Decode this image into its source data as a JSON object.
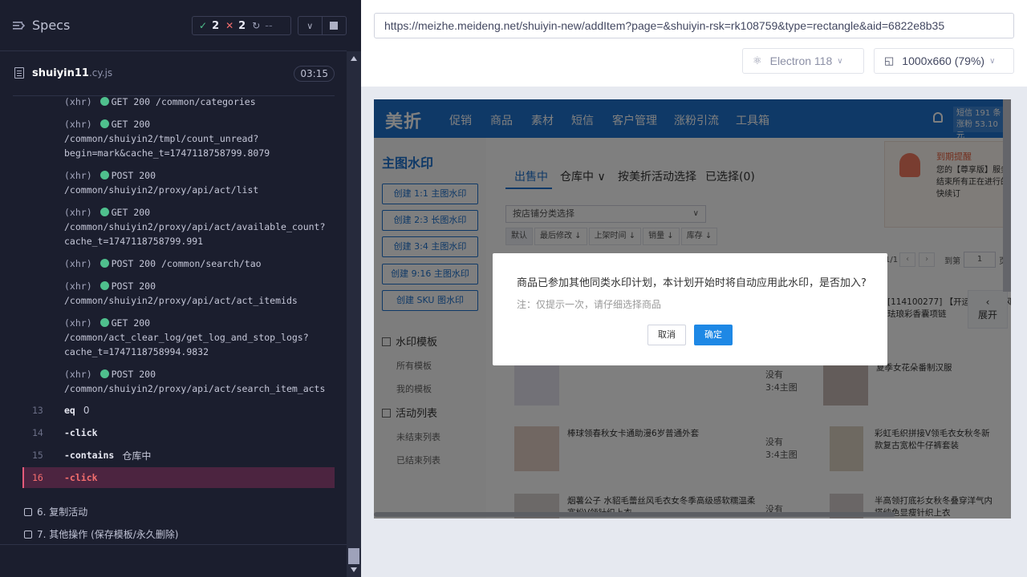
{
  "reporter": {
    "title": "Specs",
    "stats": {
      "passed": "2",
      "failed": "2",
      "pending": "--"
    },
    "spec": {
      "name": "shuiyin11",
      "ext": ".cy.js",
      "duration": "03:15"
    },
    "xhr_entries": [
      {
        "tag": "(xhr)",
        "method": "GET 200",
        "path_inline": "/common/categories",
        "path_lines": []
      },
      {
        "tag": "(xhr)",
        "method": "GET 200",
        "path_inline": "",
        "path_lines": [
          "/common/shuiyin2/tmpl/count_unread?",
          "begin=mark&cache_t=1747118758799.8079"
        ]
      },
      {
        "tag": "(xhr)",
        "method": "POST 200",
        "path_inline": "",
        "path_lines": [
          "/common/shuiyin2/proxy/api/act/list"
        ]
      },
      {
        "tag": "(xhr)",
        "method": "GET 200",
        "path_inline": "",
        "path_lines": [
          "/common/shuiyin2/proxy/api/act/available_count?",
          "cache_t=1747118758799.991"
        ]
      },
      {
        "tag": "(xhr)",
        "method": "POST 200",
        "path_inline": "/common/search/tao",
        "path_lines": []
      },
      {
        "tag": "(xhr)",
        "method": "POST 200",
        "path_inline": "",
        "path_lines": [
          "/common/shuiyin2/proxy/api/act/act_itemids"
        ]
      },
      {
        "tag": "(xhr)",
        "method": "GET 200",
        "path_inline": "",
        "path_lines": [
          "/common/act_clear_log/get_log_and_stop_logs?",
          "cache_t=1747118758994.9832"
        ]
      },
      {
        "tag": "(xhr)",
        "method": "POST 200",
        "path_inline": "",
        "path_lines": [
          "/common/shuiyin2/proxy/api/act/search_item_acts"
        ]
      }
    ],
    "commands": [
      {
        "num": "13",
        "name": "eq",
        "arg": "0"
      },
      {
        "num": "14",
        "name": "-click",
        "arg": ""
      },
      {
        "num": "15",
        "name": "-contains",
        "arg": "仓库中"
      },
      {
        "num": "16",
        "name": "-click",
        "arg": ""
      }
    ],
    "tests": [
      {
        "label": "6. 复制活动"
      },
      {
        "label": "7. 其他操作 (保存模板/永久删除)"
      }
    ]
  },
  "aut": {
    "url": "https://meizhe.meideng.net/shuiyin-new/addItem?page=&shuiyin-rsk=rk108759&type=rectangle&aid=6822e8b35",
    "browser": "Electron 118",
    "viewport": "1000x660",
    "zoom": "(79%)"
  },
  "app": {
    "logo": "美折",
    "nav": [
      "促销",
      "商品",
      "素材",
      "短信",
      "客户管理",
      "涨粉引流",
      "工具箱"
    ],
    "quota": [
      "短信 191 条",
      "涨粉 53.10 元"
    ],
    "sidebar": {
      "title": "主图水印",
      "buttons": [
        "创建 1:1 主图水印",
        "创建 2:3 长图水印",
        "创建 3:4 主图水印",
        "创建 9:16 主图水印",
        "创建 SKU 图水印"
      ],
      "section1": "水印模板",
      "section1_links": [
        "所有模板",
        "我的模板"
      ],
      "section2": "活动列表",
      "section2_links": [
        "未结束列表",
        "已结束列表"
      ]
    },
    "tabs": [
      "出售中",
      "仓库中 ∨",
      "按美折活动选择",
      "已选择(0)"
    ],
    "category_placeholder": "按店铺分类选择",
    "sort": [
      "默认",
      "最后修改 ↓",
      "上架时间 ↓",
      "销量 ↓",
      "库存 ↓"
    ],
    "pager": {
      "page": "1/1",
      "goto": "到第",
      "input": "1",
      "unit": "页"
    },
    "expand": "展开",
    "notice": {
      "title": "到期提醒",
      "text": "您的【尊享版】服务结束所有正在进行的快续订"
    },
    "products": [
      {
        "title": "",
        "status": ""
      },
      {
        "title": "[114100277] 【开运福】中国风珐琅彩香囊项链",
        "status": ""
      },
      {
        "title": "",
        "status": "没有\n3:4主图"
      },
      {
        "title": "夏季女花朵番制汉服",
        "status": ""
      },
      {
        "title": "棒球领春秋女卡通助漫6岁普通外套",
        "status": "没有\n3:4主图"
      },
      {
        "title": "彩虹毛织拼接V领毛衣女秋冬新款复古宽松牛仔裤套装",
        "status": ""
      },
      {
        "title": "烟薯公子 水貂毛蕾丝风毛衣女冬季高级感软糯温柔宽松V领针织上衣",
        "status": "没有"
      },
      {
        "title": "半高领打底衫女秋冬叠穿洋气内搭纯色显瘦针织上衣",
        "status": ""
      }
    ]
  },
  "dialog": {
    "message": "商品已参加其他同类水印计划，本计划开始时将自动应用此水印，是否加入?",
    "note": "注：仅提示一次，请仔细选择商品",
    "cancel": "取消",
    "ok": "确定"
  },
  "colors": {
    "reporter_bg": "#1b1e2e",
    "pass": "#4fc08d",
    "fail": "#f56e6e",
    "active_row": "#4c2440",
    "brand": "#1e72cf",
    "primary_btn": "#1e88e5"
  },
  "icons": {
    "specs": "list-icon",
    "pass": "check-icon",
    "fail": "cross-icon",
    "pending": "spinner-icon",
    "file": "file-icon",
    "browser": "electron-icon",
    "viewport": "viewport-icon",
    "bell": "bell-icon"
  }
}
